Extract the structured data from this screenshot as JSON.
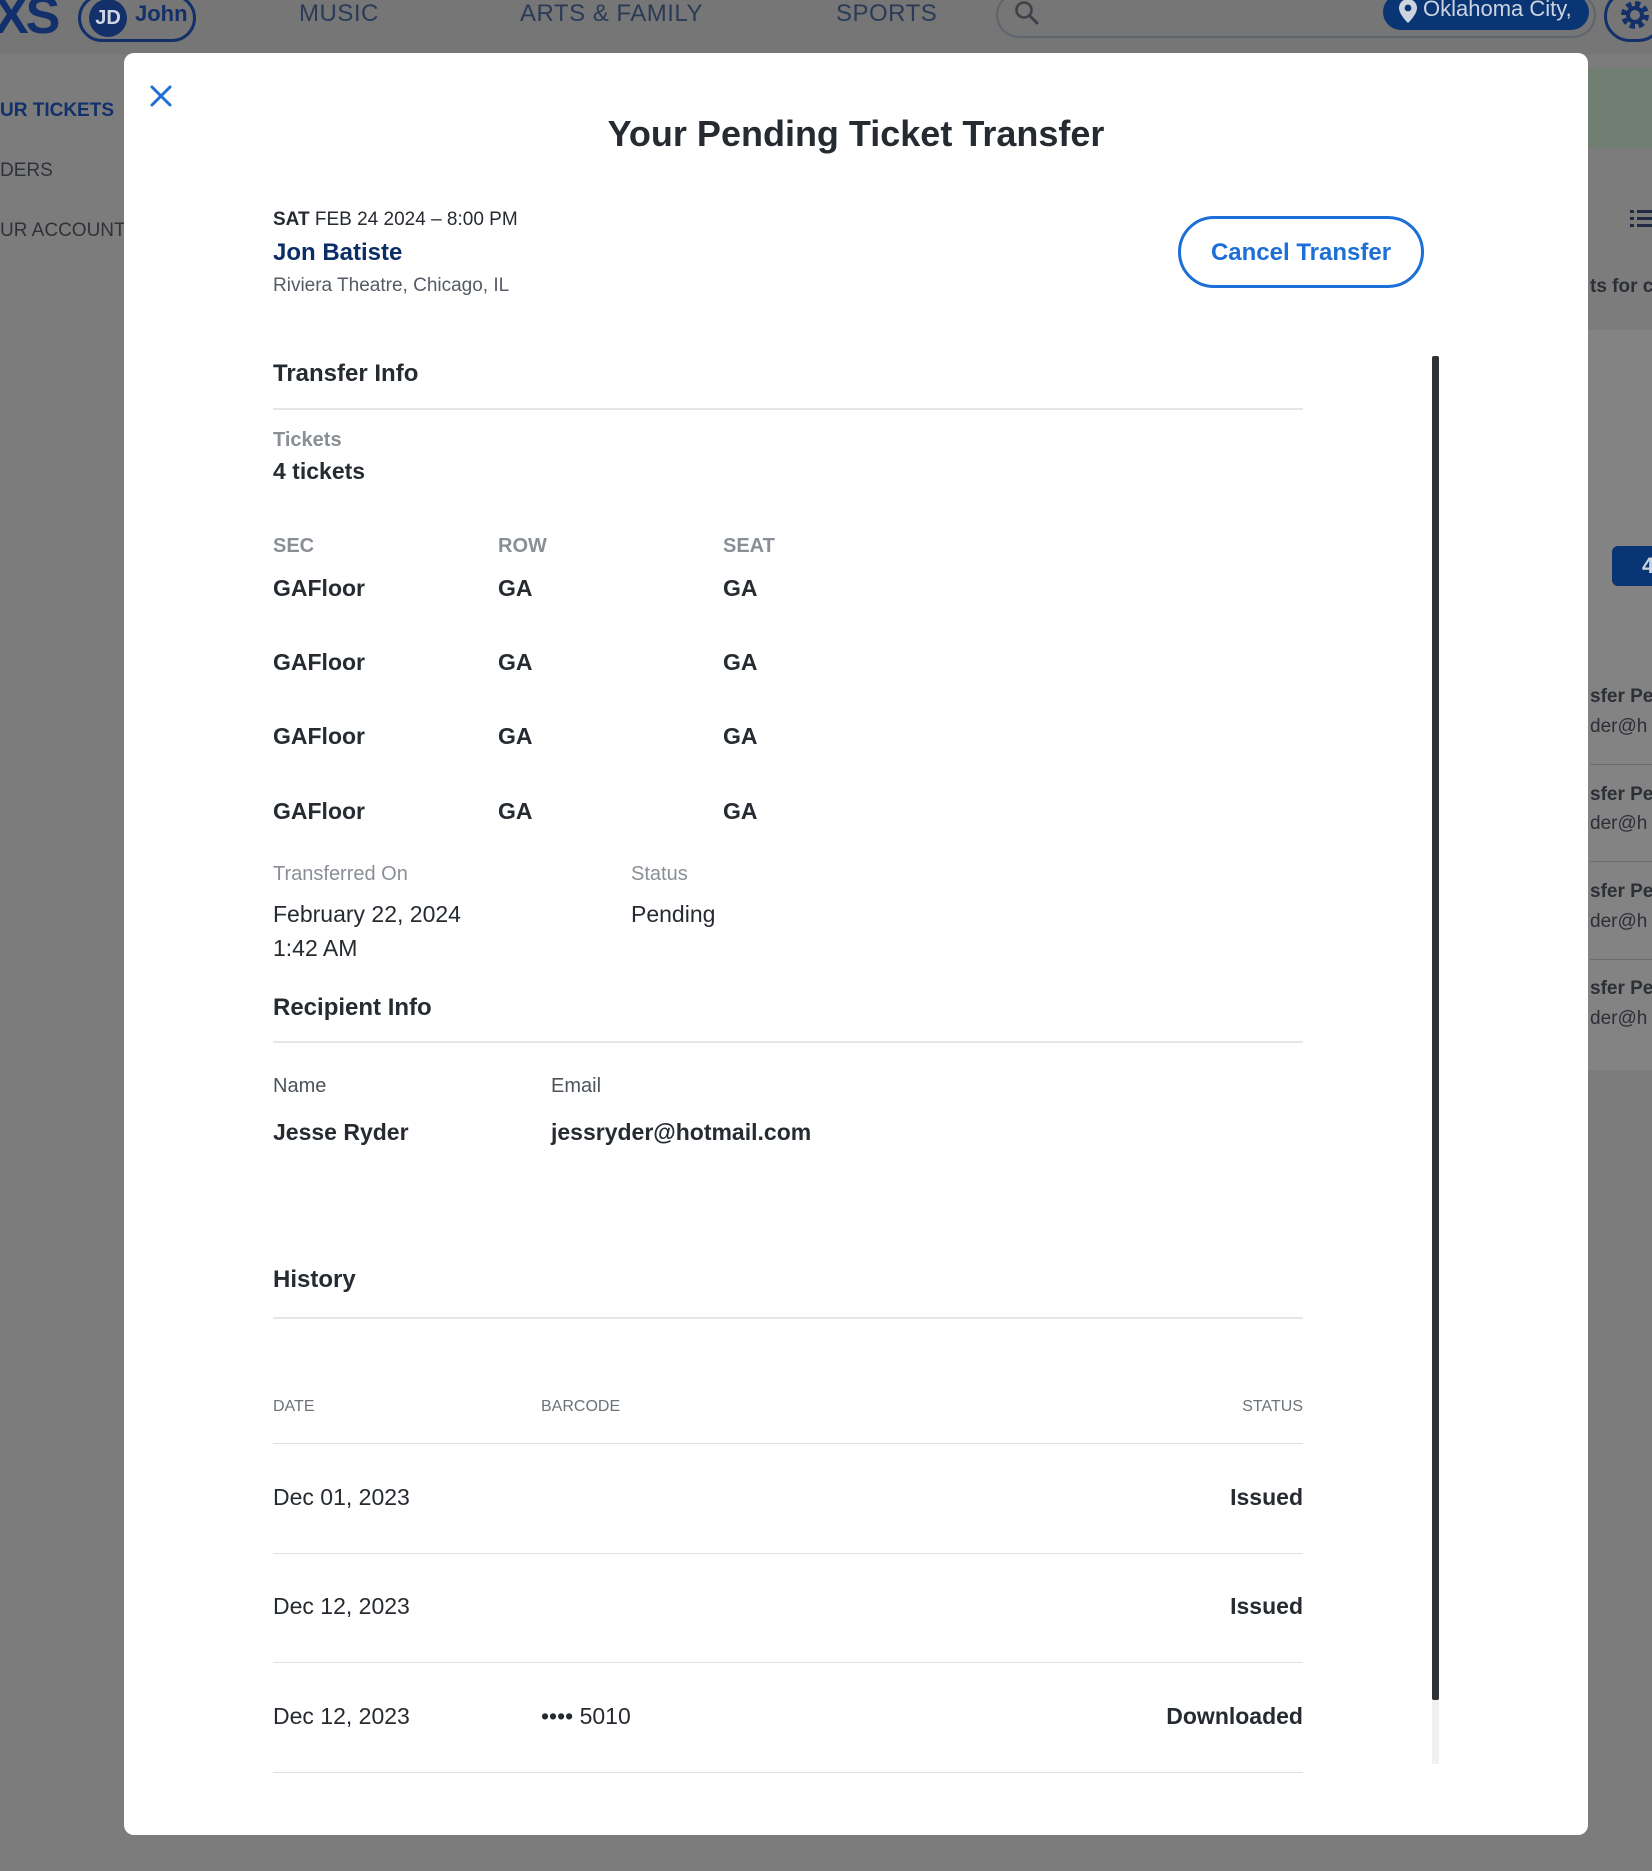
{
  "background": {
    "logo": "XS",
    "user": {
      "initials": "JD",
      "name": "John"
    },
    "nav": [
      "MUSIC",
      "ARTS & FAMILY",
      "SPORTS"
    ],
    "location": "Oklahoma City,",
    "sidebar": [
      "UR TICKETS",
      "DERS",
      "UR ACCOUNT"
    ],
    "right_panel": {
      "subtitle": "ts for c",
      "badge": "4",
      "rows": [
        {
          "title": "sfer Pe",
          "sub": "der@h"
        },
        {
          "title": "sfer Pe",
          "sub": "der@h"
        },
        {
          "title": "sfer Pe",
          "sub": "der@h"
        },
        {
          "title": "sfer Pe",
          "sub": "der@h"
        }
      ]
    }
  },
  "modal": {
    "title": "Your Pending Ticket Transfer",
    "close_icon": "close-icon",
    "event": {
      "day": "SAT",
      "date_time": "FEB 24 2024 – 8:00 PM",
      "name": "Jon Batiste",
      "venue": "Riviera Theatre, Chicago, IL"
    },
    "cancel_label": "Cancel Transfer",
    "transfer_info": {
      "heading": "Transfer Info",
      "tickets_label": "Tickets",
      "tickets_value": "4 tickets",
      "columns": [
        "SEC",
        "ROW",
        "SEAT"
      ],
      "seats": [
        {
          "sec": "GAFloor",
          "row": "GA",
          "seat": "GA"
        },
        {
          "sec": "GAFloor",
          "row": "GA",
          "seat": "GA"
        },
        {
          "sec": "GAFloor",
          "row": "GA",
          "seat": "GA"
        },
        {
          "sec": "GAFloor",
          "row": "GA",
          "seat": "GA"
        }
      ],
      "transferred_on_label": "Transferred On",
      "transferred_on_date": "February 22, 2024",
      "transferred_on_time": "1:42 AM",
      "status_label": "Status",
      "status_value": "Pending"
    },
    "recipient_info": {
      "heading": "Recipient Info",
      "name_label": "Name",
      "name_value": "Jesse Ryder",
      "email_label": "Email",
      "email_value": "jessryder@hotmail.com"
    },
    "history": {
      "heading": "History",
      "columns": [
        "DATE",
        "BARCODE",
        "STATUS"
      ],
      "rows": [
        {
          "date": "Dec 01, 2023",
          "barcode": "",
          "status": "Issued"
        },
        {
          "date": "Dec 12, 2023",
          "barcode": "",
          "status": "Issued"
        },
        {
          "date": "Dec 12, 2023",
          "barcode": "•••• 5010",
          "status": "Downloaded"
        }
      ]
    }
  },
  "colors": {
    "accent": "#1b6fd6",
    "brand_navy": "#0b2e66",
    "overlay": "#7c7c7c"
  }
}
